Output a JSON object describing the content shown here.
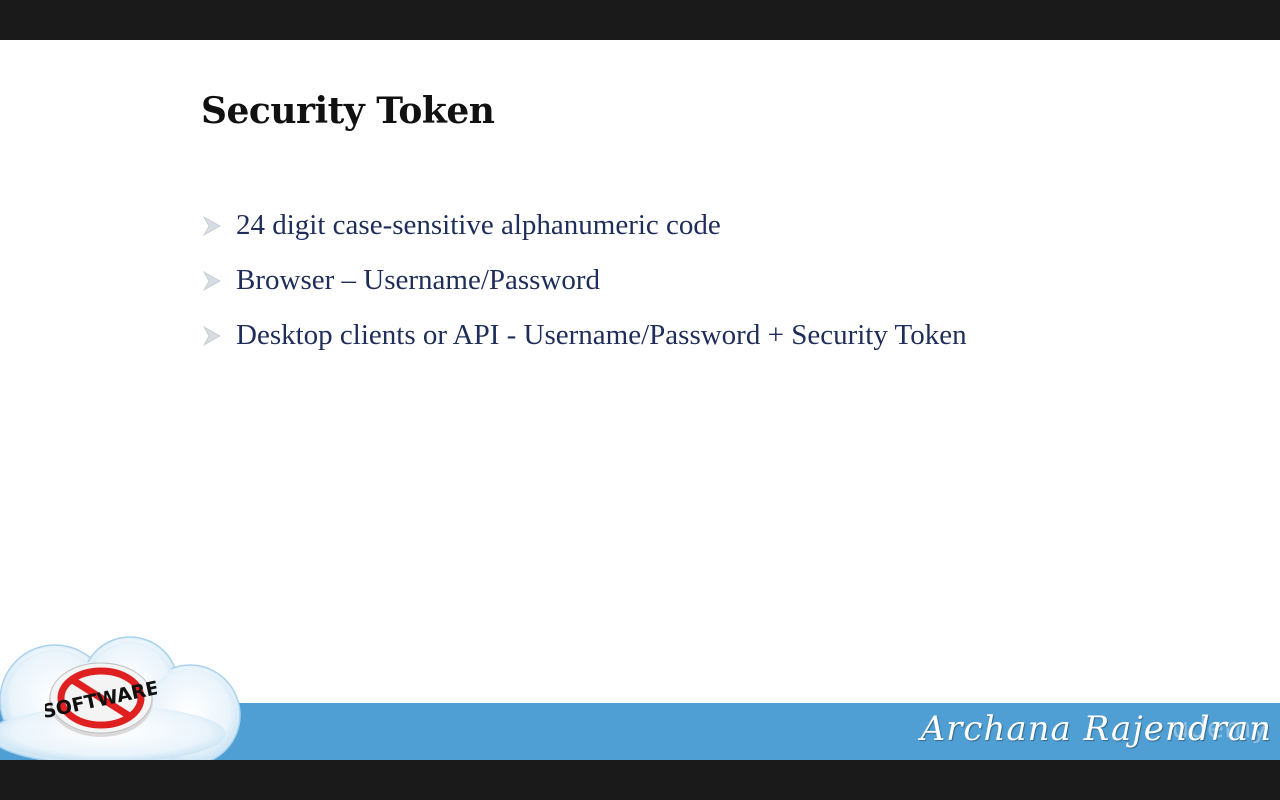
{
  "slide": {
    "title": "Security Token",
    "bullets": [
      "24 digit case-sensitive alphanumeric code",
      "Browser – Username/Password",
      "Desktop clients or API - Username/Password + Security Token"
    ]
  },
  "footer": {
    "logo_text": "SOFTWARE",
    "author": "Archana Rajendran",
    "watermark": "udemy"
  },
  "colors": {
    "band": "#4f9fd4",
    "bullet_text": "#1f2d5a",
    "bullet_marker": "#d7dbe2",
    "no_sign": "#e02020"
  },
  "icons": {
    "bullet": "arrowhead-bullet-icon",
    "logo": "no-software-logo-icon"
  }
}
